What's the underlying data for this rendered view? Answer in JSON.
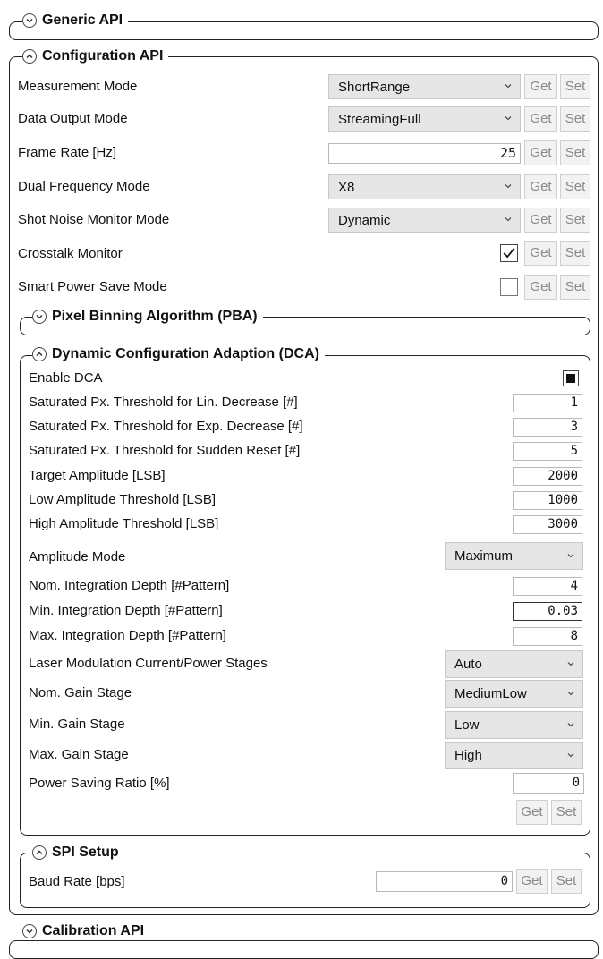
{
  "generic": {
    "title": "Generic API"
  },
  "configuration": {
    "title": "Configuration API",
    "get": "Get",
    "set": "Set",
    "rows": [
      {
        "label": "Measurement Mode",
        "value": "ShortRange"
      },
      {
        "label": "Data Output Mode",
        "value": "StreamingFull"
      },
      {
        "label": "Frame Rate [Hz]",
        "value": "25"
      },
      {
        "label": "Dual Frequency Mode",
        "value": "X8"
      },
      {
        "label": "Shot Noise Monitor Mode",
        "value": "Dynamic"
      },
      {
        "label": "Crosstalk Monitor",
        "checked": true
      },
      {
        "label": "Smart Power Save Mode",
        "checked": false
      }
    ]
  },
  "pba": {
    "title": "Pixel Binning Algorithm (PBA)"
  },
  "dca": {
    "title": "Dynamic Configuration Adaption (DCA)",
    "get": "Get",
    "set": "Set",
    "rows": [
      {
        "label": "Enable DCA",
        "indeterminate": true
      },
      {
        "label": "Saturated Px. Threshold for Lin. Decrease [#]",
        "value": "1"
      },
      {
        "label": "Saturated Px. Threshold for Exp. Decrease [#]",
        "value": "3"
      },
      {
        "label": "Saturated Px. Threshold for Sudden Reset [#]",
        "value": "5"
      },
      {
        "label": "Target Amplitude [LSB]",
        "value": "2000"
      },
      {
        "label": "Low Amplitude Threshold [LSB]",
        "value": "1000"
      },
      {
        "label": "High Amplitude Threshold [LSB]",
        "value": "3000"
      },
      {
        "label": "Amplitude Mode",
        "value": "Maximum"
      },
      {
        "label": "Nom. Integration Depth [#Pattern]",
        "value": "4"
      },
      {
        "label": "Min. Integration Depth [#Pattern]",
        "value": "0.03"
      },
      {
        "label": "Max. Integration Depth [#Pattern]",
        "value": "8"
      },
      {
        "label": "Laser Modulation Current/Power Stages",
        "value": "Auto"
      },
      {
        "label": "Nom. Gain Stage",
        "value": "MediumLow"
      },
      {
        "label": "Min. Gain Stage",
        "value": "Low"
      },
      {
        "label": "Max. Gain Stage",
        "value": "High"
      },
      {
        "label": "Power Saving Ratio [%]",
        "value": "0"
      }
    ]
  },
  "spi": {
    "title": "SPI Setup",
    "baud_label": "Baud Rate [bps]",
    "baud_value": "0",
    "get": "Get",
    "set": "Set"
  },
  "calibration": {
    "title": "Calibration API"
  }
}
